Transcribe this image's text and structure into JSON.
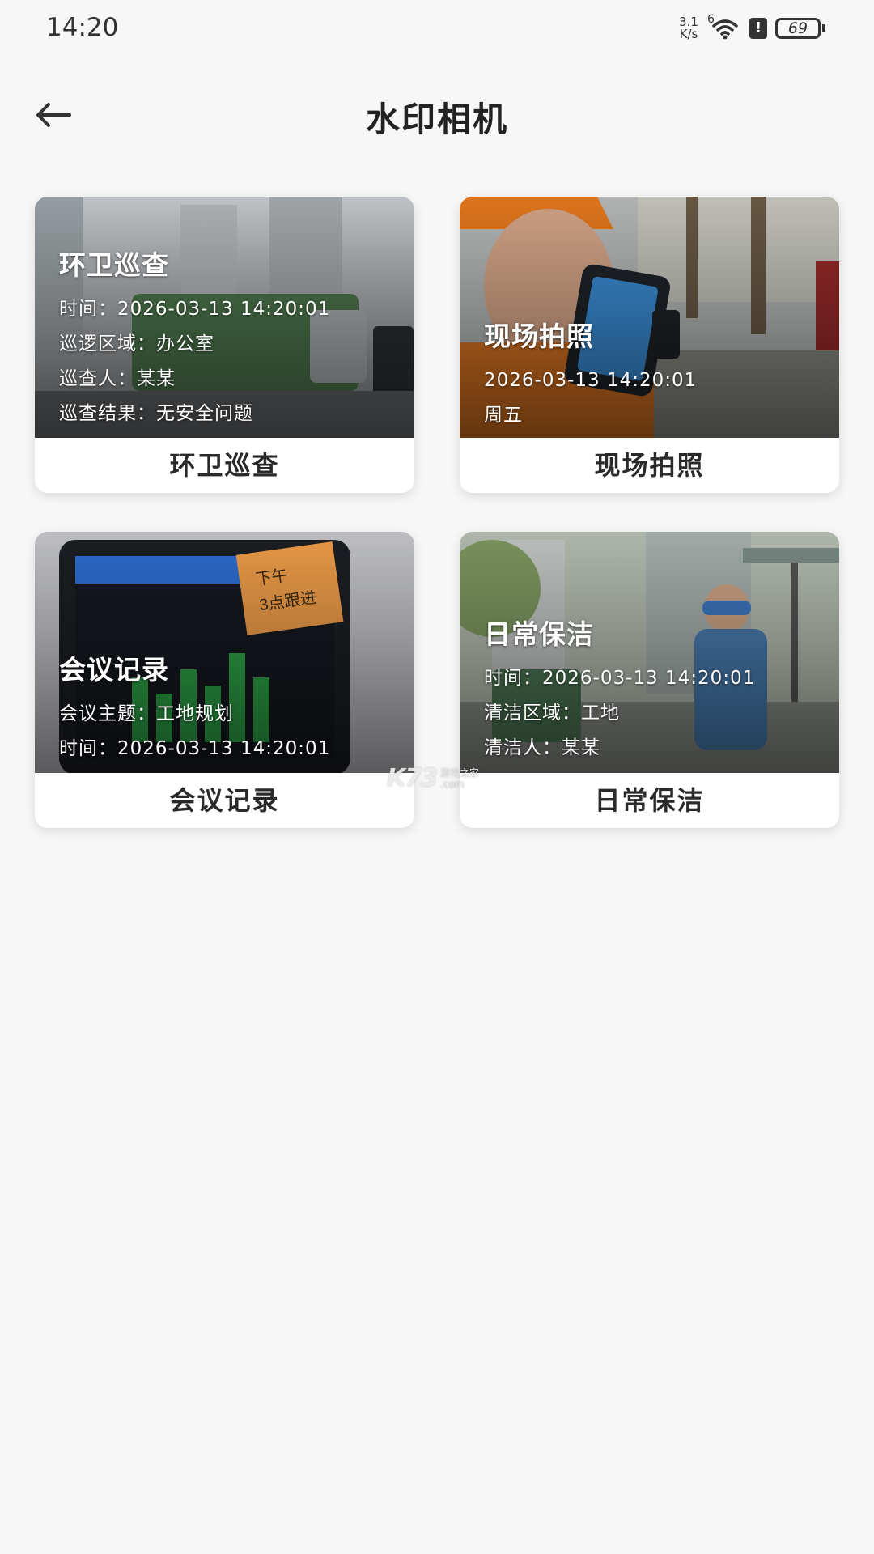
{
  "status_bar": {
    "time": "14:20",
    "net_speed_value": "3.1",
    "net_speed_unit": "K/s",
    "wifi_badge": "6",
    "battery": "69"
  },
  "header": {
    "title": "水印相机"
  },
  "cards": [
    {
      "overlay_title": "环卫巡查",
      "overlay_lines": [
        "时间：2026-03-13 14:20:01",
        "巡逻区域：办公室",
        "巡查人：某某",
        "巡查结果：无安全问题"
      ],
      "label": "环卫巡查"
    },
    {
      "overlay_title": "现场拍照",
      "overlay_lines": [
        "2026-03-13 14:20:01",
        "周五"
      ],
      "label": "现场拍照"
    },
    {
      "overlay_title": "会议记录",
      "overlay_lines": [
        "会议主题：工地规划",
        "时间：2026-03-13 14:20:01"
      ],
      "label": "会议记录"
    },
    {
      "overlay_title": "日常保洁",
      "overlay_lines": [
        "时间：2026-03-13 14:20:01",
        "清洁区域：工地",
        "清洁人：某某"
      ],
      "label": "日常保洁"
    }
  ],
  "watermark": {
    "main": "K73",
    "sub_top": "游戏之家",
    "sub_bottom": ".com"
  }
}
